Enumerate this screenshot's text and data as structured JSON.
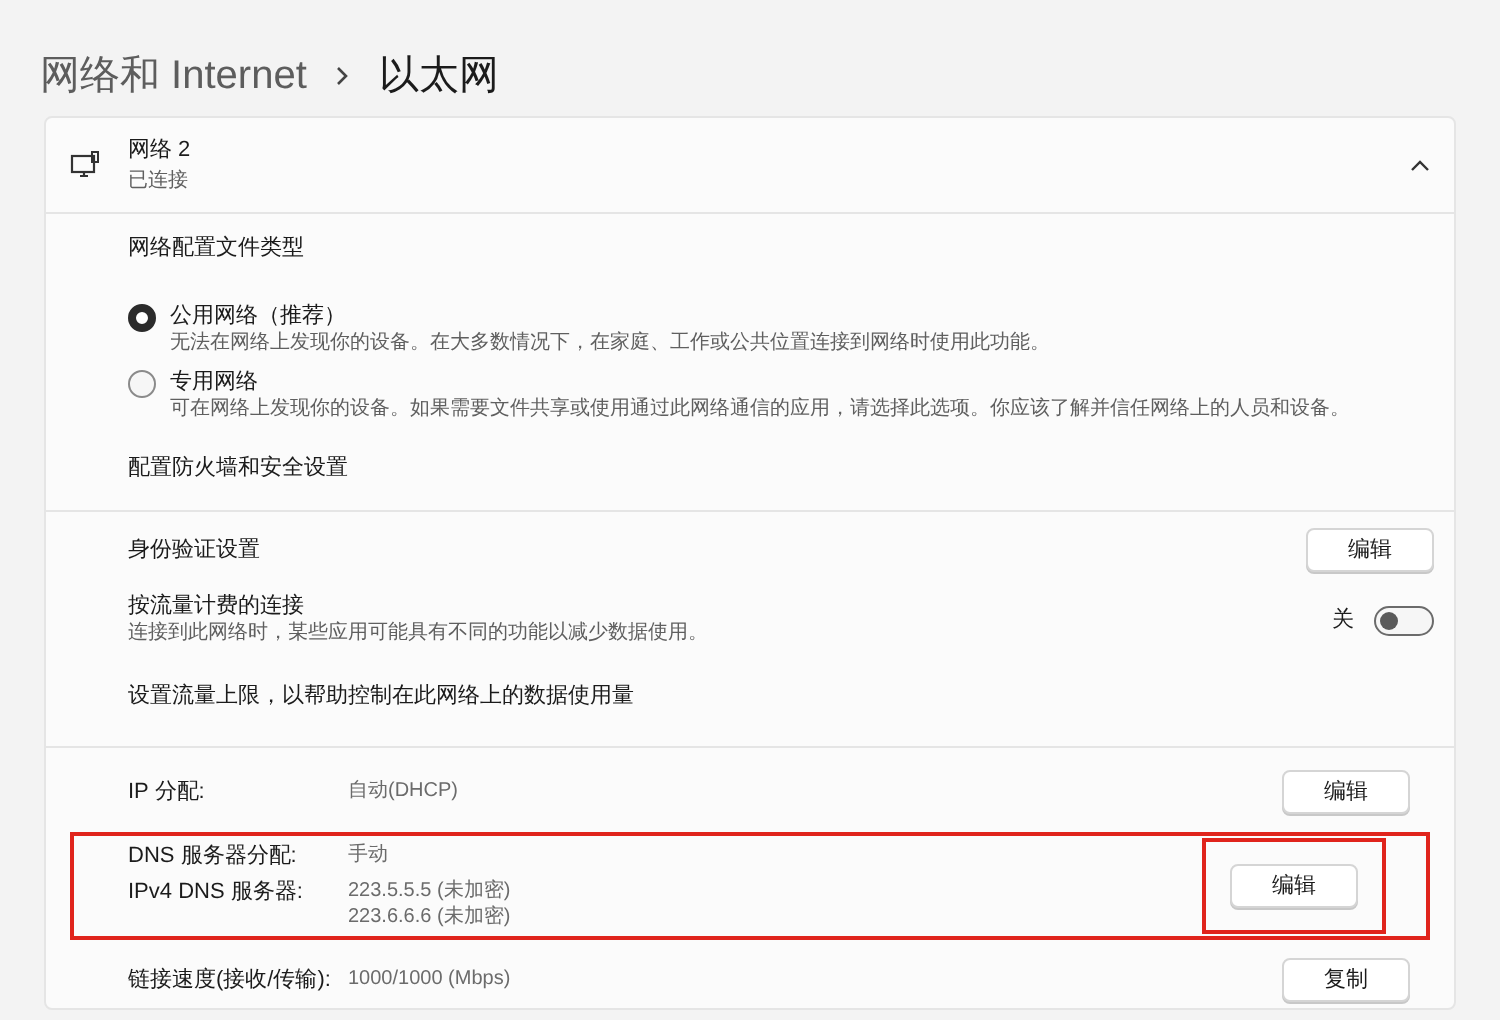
{
  "breadcrumb": [
    {
      "label": "网络和 Internet",
      "current": false
    },
    {
      "label": "以太网",
      "current": true
    }
  ],
  "adapter": {
    "name": "网络 2",
    "status": "已连接",
    "expanded": true
  },
  "profile": {
    "title": "网络配置文件类型",
    "options": [
      {
        "label": "公用网络（推荐）",
        "description": "无法在网络上发现你的设备。在大多数情况下，在家庭、工作或公共位置连接到网络时使用此功能。",
        "selected": true
      },
      {
        "label": "专用网络",
        "description": "可在网络上发现你的设备。如果需要文件共享或使用通过此网络通信的应用，请选择此选项。你应该了解并信任网络上的人员和设备。",
        "selected": false
      }
    ],
    "link": "配置防火墙和安全设置"
  },
  "settings": [
    {
      "kind": "button",
      "label": "身份验证设置",
      "button": "编辑"
    },
    {
      "kind": "toggle",
      "label": "按流量计费的连接",
      "description": "连接到此网络时，某些应用可能具有不同的功能以减少数据使用。",
      "state_label": "关",
      "on": false
    },
    {
      "kind": "link",
      "label": "设置流量上限，以帮助控制在此网络上的数据使用量"
    }
  ],
  "properties": [
    {
      "rows": [
        {
          "label": "IP 分配:",
          "values": [
            "自动(DHCP)"
          ]
        }
      ],
      "button": "编辑",
      "highlighted": false
    },
    {
      "rows": [
        {
          "label": "DNS 服务器分配:",
          "values": [
            "手动"
          ]
        },
        {
          "label": "IPv4 DNS 服务器:",
          "values": [
            "223.5.5.5 (未加密)",
            "223.6.6.6 (未加密)"
          ]
        }
      ],
      "button": "编辑",
      "highlighted": true
    },
    {
      "rows": [
        {
          "label": "链接速度(接收/传输):",
          "values": [
            "1000/1000 (Mbps)"
          ]
        }
      ],
      "button": "复制",
      "highlighted": false
    }
  ]
}
